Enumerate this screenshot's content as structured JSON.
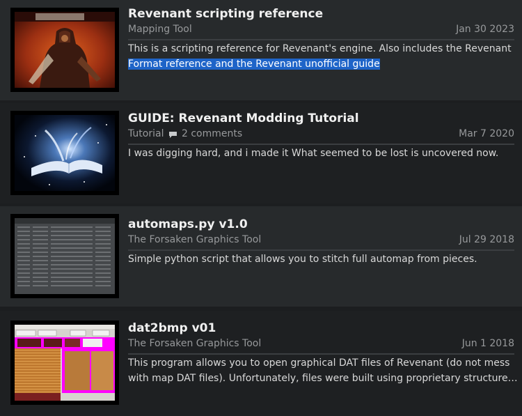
{
  "items": [
    {
      "title": "Revenant scripting reference",
      "category": "Mapping Tool",
      "date": "Jan 30 2023",
      "description_line1": "This is a scripting reference for Revenant's engine. Also includes the Revenant",
      "description_line2_selected": "Format reference and the Revenant unofficial guide",
      "thumbnail": "revenant-warrior-art"
    },
    {
      "title": "GUIDE: Revenant Modding Tutorial",
      "category": "Tutorial",
      "comments": "2 comments",
      "comments_icon": "comment-bubble-icon",
      "date": "Mar 7 2020",
      "description": "I was digging hard, and i made it What seemed to be lost is uncovered now.",
      "thumbnail": "glowing-book-art"
    },
    {
      "title": "automaps.py v1.0",
      "category": "The Forsaken Graphics Tool",
      "date": "Jul 29 2018",
      "description": "Simple python script that allows you to stitch full automap from pieces.",
      "thumbnail": "terminal-output-screenshot"
    },
    {
      "title": "dat2bmp v01",
      "category": "The Forsaken Graphics Tool",
      "date": "Jun 1 2018",
      "description_line1": "This program allows you to open graphical DAT files of Revenant (do not mess",
      "description_line2": "with map DAT files). Unfortunately, files were built using proprietary structure…",
      "thumbnail": "dat2bmp-app-screenshot"
    }
  ],
  "colors": {
    "row_light": "#272a2c",
    "row_dark": "#1e2022",
    "title": "#f0f0f0",
    "meta": "#97999b",
    "description": "#d9d9d9",
    "selection": "#1e64c8"
  }
}
